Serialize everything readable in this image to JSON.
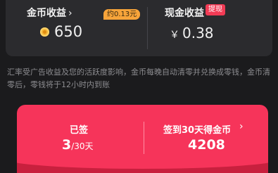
{
  "coin_income": {
    "title": "金币收益",
    "chevron": "›",
    "approx_badge": "约0.13元",
    "icon": "coin-icon",
    "value": "650"
  },
  "cash_income": {
    "title": "现金收益",
    "withdraw_badge": "提现",
    "currency": "￥",
    "value": "0.38"
  },
  "note": "汇率受广告收益及您的活跃度影响，金币每晚自动清零并兑换成零钱，金币清零后，零钱将于12小时内到账",
  "signin": {
    "signed_label": "已签",
    "signed_days": "3",
    "total_days": "/30天",
    "reward_label": "签到30天得金币",
    "reward_chevron": "›",
    "reward_value": "4208"
  },
  "colors": {
    "accent_red": "#f6345a",
    "badge_orange": "#f7a43a",
    "badge_red": "#f23b55"
  }
}
